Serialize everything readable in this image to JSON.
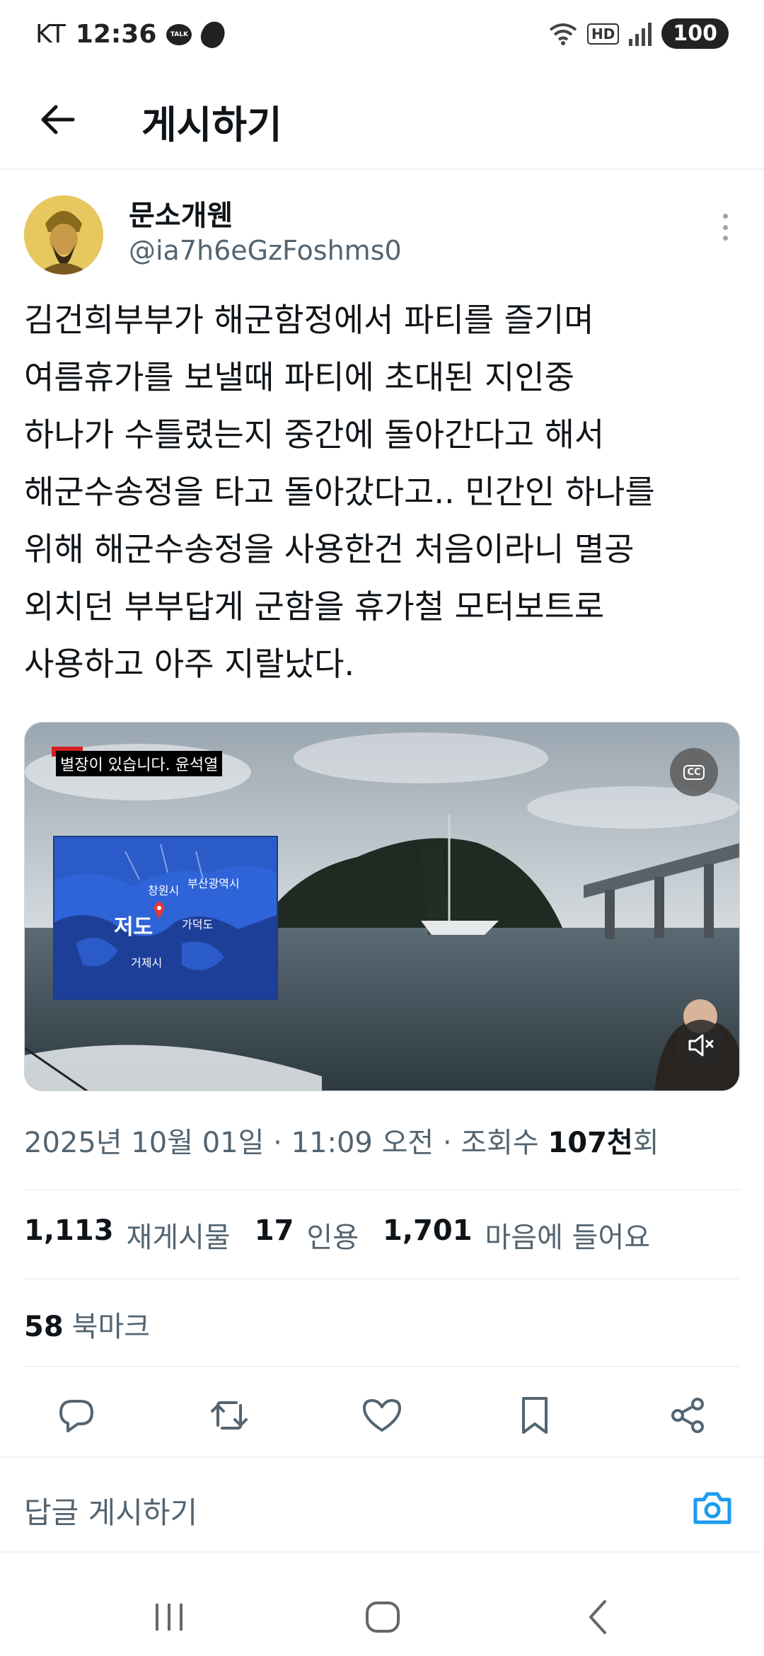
{
  "status_bar": {
    "carrier": "KT",
    "time": "12:36",
    "talk_badge": "TALK",
    "hd": "HD",
    "battery": "100"
  },
  "header": {
    "title": "게시하기"
  },
  "author": {
    "display_name": "문소개웬",
    "handle": "@ia7h6eGzFoshms0"
  },
  "post": {
    "lines": [
      "김건희부부가 해군함정에서 파티를 즐기며",
      "여름휴가를 보낼때 파티에 초대된 지인중",
      "하나가 수틀렸는지 중간에 돌아간다고 해서",
      "해군수송정을 타고 돌아갔다고.. 민간인 하나를",
      "위해 해군수송정을 사용한건 처음이라니 멸공",
      "외치던 부부답게 군함을 휴가철 모터보트로",
      "사용하고 아주 지랄났다."
    ]
  },
  "media": {
    "caption": "별장이 있습니다. 윤석열",
    "cc_label": "CC",
    "map_main_label": "저도",
    "map_labels": [
      "창원시",
      "부산광역시",
      "가덕도",
      "거제시"
    ]
  },
  "meta": {
    "date": "2025년 10월 01일",
    "separator": " · ",
    "time": "11:09 오전",
    "views_label": "조회수 ",
    "views_value": "107천",
    "views_suffix": "회"
  },
  "stats": {
    "reposts_count": "1,113",
    "reposts_label": "재게시물",
    "quotes_count": "17",
    "quotes_label": "인용",
    "likes_count": "1,701",
    "likes_label": "마음에 들어요",
    "bookmarks_count": "58",
    "bookmarks_label": "북마크"
  },
  "reply": {
    "placeholder": "답글 게시하기"
  },
  "colors": {
    "text_primary": "#0f1419",
    "text_secondary": "#536471",
    "accent": "#1d9bf0",
    "divider": "#eff3f4"
  },
  "icons": [
    "back-arrow-icon",
    "more-vertical-icon",
    "reply-icon",
    "repost-icon",
    "like-icon",
    "bookmark-icon",
    "share-icon",
    "camera-icon",
    "cc-icon",
    "mute-icon"
  ]
}
